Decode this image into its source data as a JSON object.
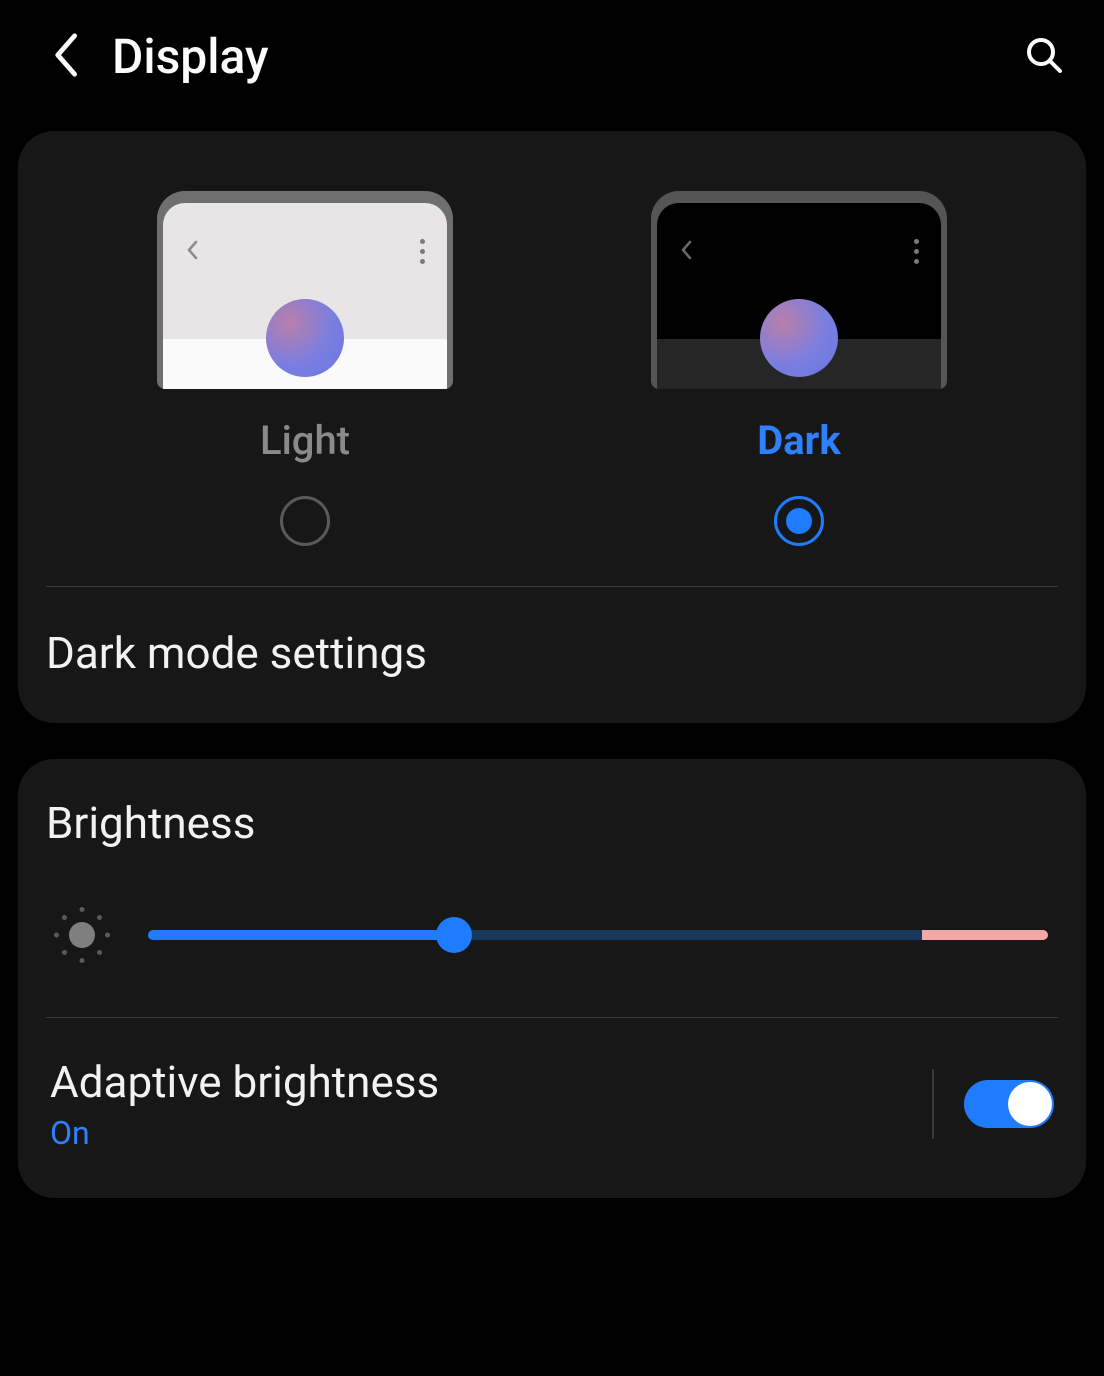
{
  "header": {
    "title": "Display"
  },
  "theme": {
    "light_label": "Light",
    "dark_label": "Dark",
    "selected": "dark"
  },
  "dark_mode_settings_label": "Dark mode settings",
  "brightness": {
    "title": "Brightness",
    "value_percent": 34,
    "warn_zone_percent": 14
  },
  "adaptive": {
    "title": "Adaptive brightness",
    "status": "On",
    "enabled": true
  },
  "colors": {
    "accent": "#1f7cff",
    "card_bg": "#171717",
    "inactive_text": "#8a8a8a"
  }
}
